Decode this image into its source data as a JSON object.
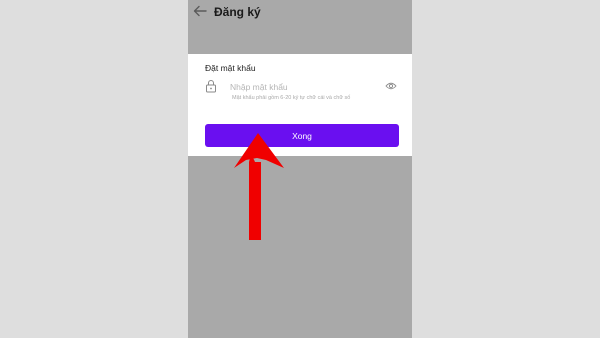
{
  "app_bar": {
    "title": "Đăng ký",
    "back_icon": "arrow-left-icon"
  },
  "password_sheet": {
    "title": "Đặt mật khẩu",
    "lock_icon": "lock-icon",
    "input_placeholder": "Nhập mật khẩu",
    "input_value": "",
    "eye_icon": "eye-icon",
    "hint": "Mật khẩu phải gồm 6-20 ký tự chữ cái và chữ số",
    "done_label": "Xong"
  },
  "colors": {
    "primary_button": "#6a0ff0",
    "dim_overlay": "#a9a9a9",
    "annotation_arrow": "#f00000"
  }
}
